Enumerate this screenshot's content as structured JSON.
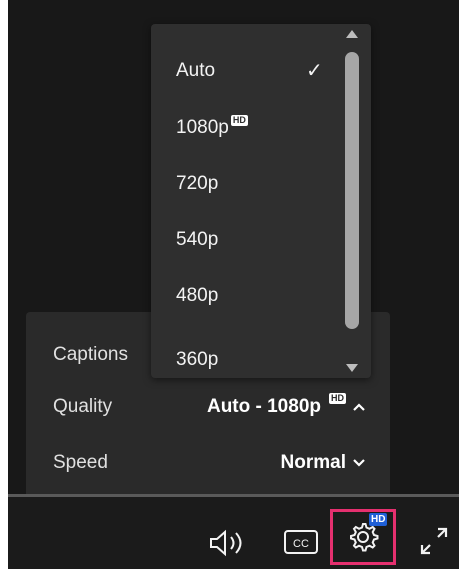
{
  "settings": {
    "rows": [
      {
        "label": "Captions",
        "value": ""
      },
      {
        "label": "Quality",
        "value": "Auto - 1080p",
        "badge": "HD",
        "icon": "chevron-up-icon"
      },
      {
        "label": "Speed",
        "value": "Normal",
        "icon": "chevron-down-icon"
      }
    ]
  },
  "quality_menu": {
    "options": [
      {
        "label": "Auto",
        "selected": true
      },
      {
        "label": "1080p",
        "badge": "HD"
      },
      {
        "label": "720p"
      },
      {
        "label": "540p"
      },
      {
        "label": "480p"
      },
      {
        "label": "360p"
      }
    ],
    "selected_mark": "✓"
  },
  "controls": {
    "volume_icon": "speaker-icon",
    "captions_label": "CC",
    "settings_icon": "gear-icon",
    "settings_badge": "HD",
    "fullscreen_icon": "fullscreen-icon"
  },
  "colors": {
    "highlight_border": "#e5306f",
    "hd_badge": "#1f5fd6"
  }
}
